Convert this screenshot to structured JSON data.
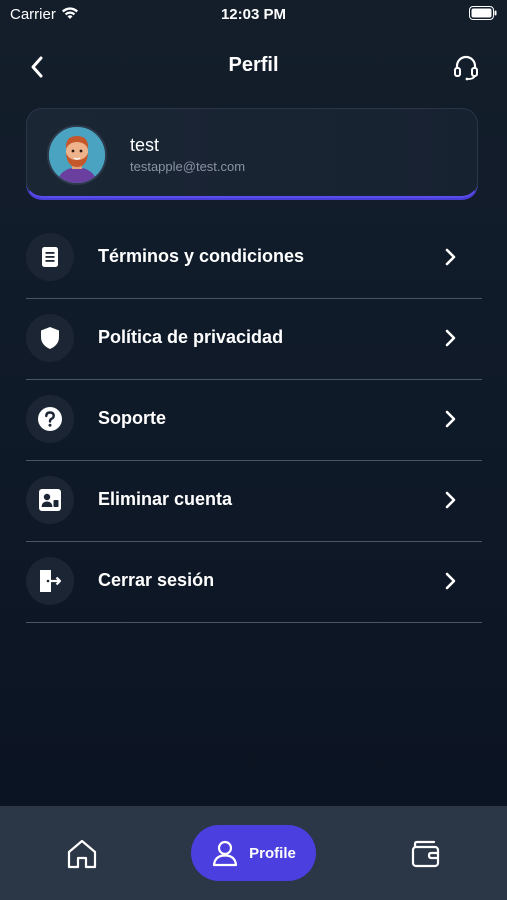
{
  "status_bar": {
    "carrier": "Carrier",
    "time": "12:03 PM"
  },
  "header": {
    "title": "Perfil",
    "back_icon": "chevron-left-icon",
    "support_icon": "headset-icon"
  },
  "profile": {
    "name": "test",
    "email": "testapple@test.com"
  },
  "menu": {
    "items": [
      {
        "label": "Términos y condiciones",
        "icon": "document-icon"
      },
      {
        "label": "Política de privacidad",
        "icon": "shield-icon"
      },
      {
        "label": "Soporte",
        "icon": "help-icon"
      },
      {
        "label": "Eliminar cuenta",
        "icon": "account-badge-icon"
      },
      {
        "label": "Cerrar sesión",
        "icon": "logout-icon"
      }
    ]
  },
  "tab_bar": {
    "home_icon": "home-icon",
    "profile_label": "Profile",
    "wallet_icon": "wallet-icon"
  },
  "colors": {
    "accent": "#4b3fe0",
    "background": "#0f1a29",
    "tab_bar": "#2b3646"
  }
}
